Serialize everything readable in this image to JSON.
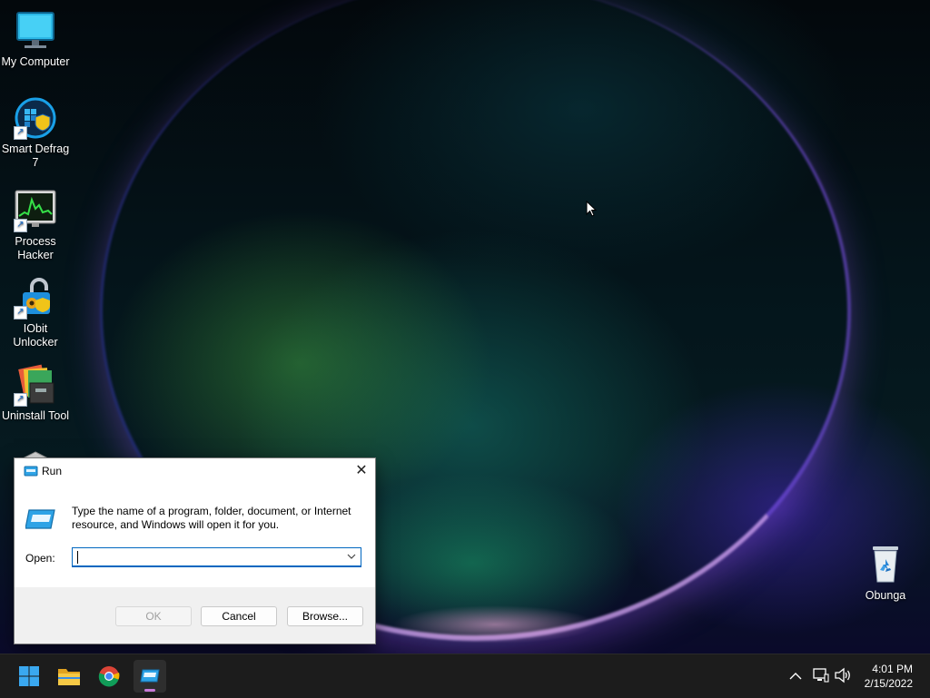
{
  "desktop": {
    "icons": [
      {
        "label": "My Computer",
        "icon": "monitor-icon"
      },
      {
        "label": "Smart Defrag 7",
        "icon": "smart-defrag-icon"
      },
      {
        "label": "Process Hacker",
        "icon": "process-hacker-icon"
      },
      {
        "label": "IObit Unlocker",
        "icon": "iobit-unlocker-icon"
      },
      {
        "label": "Uninstall Tool",
        "icon": "uninstall-tool-icon"
      }
    ],
    "recycle_bin": {
      "label": "Obunga",
      "icon": "recycle-bin-icon"
    }
  },
  "run_dialog": {
    "title": "Run",
    "description": "Type the name of a program, folder, document, or Internet resource, and Windows will open it for you.",
    "open_label": "Open:",
    "input_value": "",
    "ok_label": "OK",
    "cancel_label": "Cancel",
    "browse_label": "Browse...",
    "close_glyph": "✕"
  },
  "taskbar": {
    "items": [
      {
        "name": "start",
        "icon": "windows-logo-icon"
      },
      {
        "name": "file-explorer",
        "icon": "folder-icon"
      },
      {
        "name": "chrome",
        "icon": "chrome-icon"
      },
      {
        "name": "run",
        "icon": "run-icon",
        "active": true
      }
    ],
    "tray": {
      "chevron": "^",
      "network": "network-icon",
      "volume": "volume-icon"
    },
    "clock": {
      "time": "4:01 PM",
      "date": "2/15/2022"
    }
  },
  "colors": {
    "accent": "#0067c0",
    "taskbar_bg": "#1c1c1c",
    "active_indicator": "#c97ad9"
  }
}
